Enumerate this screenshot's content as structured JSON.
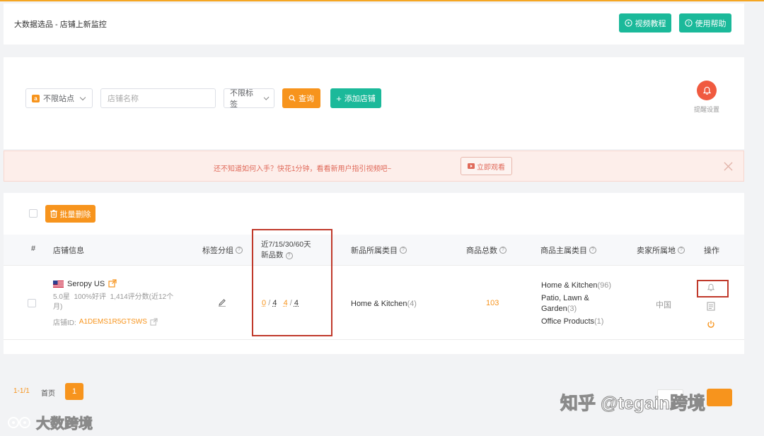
{
  "header": {
    "breadcrumb": "大数据选品 - 店铺上新监控",
    "video_tutorial": "视频教程",
    "help": "使用帮助"
  },
  "filters": {
    "site_select": "不限站点",
    "shop_name_placeholder": "店铺名称",
    "tag_select": "不限标签",
    "search_button": "查询",
    "add_shop_button": "添加店铺",
    "alert_settings": "提醒设置"
  },
  "banner": {
    "text": "还不知道如何入手？快花1分钟，看看新用户指引视频吧~",
    "watch_button": "立即观看"
  },
  "toolbar": {
    "bulk_delete": "批量删除"
  },
  "table": {
    "headers": {
      "index": "#",
      "shop_info": "店铺信息",
      "tag_group": "标签分组",
      "new_count_line1": "近7/15/30/60天",
      "new_count_line2": "新品数",
      "new_category": "新品所属类目",
      "total": "商品总数",
      "main_category": "商品主属类目",
      "seller_location": "卖家所属地",
      "actions": "操作"
    },
    "rows": [
      {
        "shop_name": "Seropy US",
        "rating": "5.0星",
        "positive": "100%好评",
        "reviews": "1,414评分数(近12个",
        "reviews_cont": "月)",
        "shop_id_label": "店铺ID:",
        "shop_id": "A1DEMS1R5GTSWS",
        "new_7": "0",
        "new_15": "4",
        "new_30": "4",
        "new_60": "4",
        "sep": "/",
        "new_category_name": "Home & Kitchen",
        "new_category_count": "(4)",
        "total": "103",
        "main_categories": [
          {
            "name": "Home & Kitchen",
            "count": "(96)"
          },
          {
            "name": "Patio, Lawn &",
            "name2": "Garden",
            "count": "(3)"
          },
          {
            "name": "Office Products",
            "count": "(1)"
          }
        ],
        "location": "中国"
      }
    ]
  },
  "pagination": {
    "range": "1-1/1",
    "first": "首页",
    "current": "1"
  },
  "watermarks": {
    "left": "大数跨境",
    "right": "知乎 @tegain跨境"
  },
  "colors": {
    "accent_orange": "#f7941d",
    "green": "#1bb99a",
    "alert_red": "#f05a3f",
    "highlight_red": "#c0392b"
  }
}
